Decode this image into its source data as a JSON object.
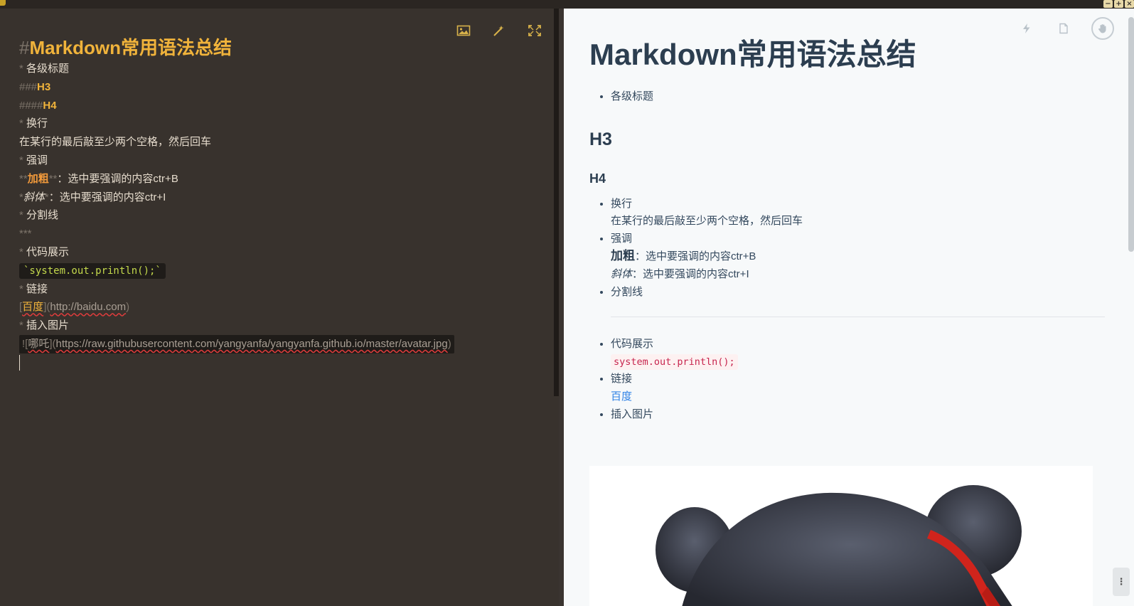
{
  "window": {
    "controls": [
      "−",
      "+",
      "×"
    ]
  },
  "editor": {
    "toolbar": {
      "insert_image_icon": "image-icon",
      "magic_icon": "magic-wand-icon",
      "fullscreen_icon": "expand-icon"
    },
    "lines": {
      "h1_mark": "#",
      "h1_text": "Markdown常用语法总结",
      "l1_mark": "* ",
      "l1_text": "各级标题",
      "h3_mark": "###",
      "h3_text": "H3",
      "h4_mark": "####",
      "h4_text": "H4",
      "l2_mark": "* ",
      "l2_text": "换行",
      "l2_body": "在某行的最后敲至少两个空格，然后回车",
      "l3_mark": "* ",
      "l3_text": "强调",
      "bold_open": "**",
      "bold_text": "加粗",
      "bold_close": "**",
      "bold_rest": "：选中要强调的内容ctr+B",
      "ital_open": "*",
      "ital_text": "斜体",
      "ital_close": "*",
      "ital_rest": "：选中要强调的内容ctr+I",
      "l4_mark": "* ",
      "l4_text": "分割线",
      "hr_src": "***",
      "l5_mark": "* ",
      "l5_text": "代码展示",
      "code_src": "`system.out.println();`",
      "l6_mark": "* ",
      "l6_text": "链接",
      "link_open": "[",
      "link_text": "百度",
      "link_mid": "](",
      "link_url": "http://baidu.com",
      "link_close": ")",
      "l7_mark": "* ",
      "l7_text": "插入图片",
      "img_open": "![",
      "img_alt": "哪吒",
      "img_mid": "](",
      "img_url": "https://raw.githubusercontent.com/yangyanfa/yangyanfa.github.io/master/avatar.jpg",
      "img_close": ")"
    }
  },
  "preview": {
    "toolbar": {
      "flash_icon": "lightning-icon",
      "doc_icon": "document-icon",
      "hand_icon": "hand-icon"
    },
    "h1": "Markdown常用语法总结",
    "item1": "各级标题",
    "h3": "H3",
    "h4": "H4",
    "item2": "换行",
    "item2_body": "在某行的最后敲至少两个空格，然后回车",
    "item3": "强调",
    "bold_text": "加粗",
    "bold_rest": "：选中要强调的内容ctr+B",
    "ital_text": "斜体",
    "ital_rest": "：选中要强调的内容ctr+I",
    "item4": "分割线",
    "item5": "代码展示",
    "code_text": "system.out.println();",
    "item6": "链接",
    "link_text": "百度",
    "item7": "插入图片",
    "image_alt": "哪吒"
  },
  "colors": {
    "editor_bg": "#38322d",
    "heading_src": "#f0b33b",
    "bold_src": "#f29a3b",
    "code_src": "#c4d94c",
    "preview_bg": "#f7f9fa",
    "preview_text": "#2c3e50",
    "link": "#2f82e6",
    "code_preview": "#c7254e"
  }
}
